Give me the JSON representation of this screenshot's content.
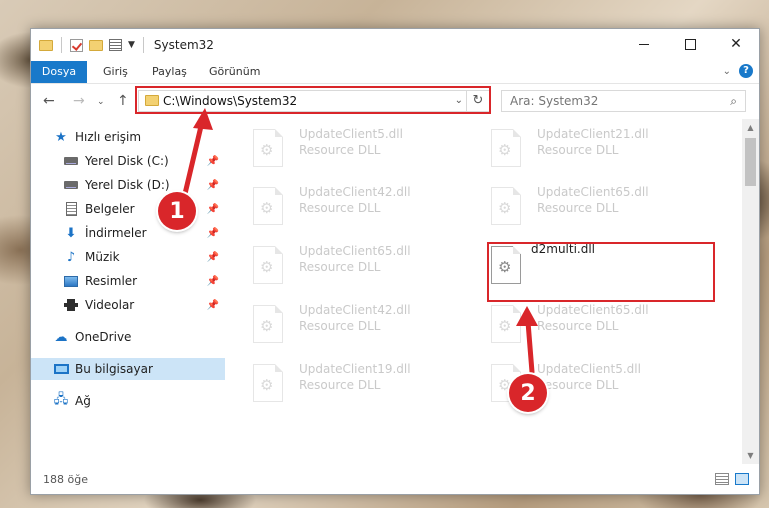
{
  "window": {
    "title": "System32",
    "controls": {
      "minimize": "—",
      "maximize": "☐",
      "close": "✕"
    }
  },
  "ribbon": {
    "tabs": [
      "Dosya",
      "Giriş",
      "Paylaş",
      "Görünüm"
    ],
    "help": "?"
  },
  "address": {
    "path": "C:\\Windows\\System32",
    "search_placeholder": "Ara: System32"
  },
  "nav": {
    "quick_access": "Hızlı erişim",
    "items": [
      {
        "label": "Yerel Disk (C:)",
        "icon": "drive-icon"
      },
      {
        "label": "Yerel Disk (D:)",
        "icon": "drive-icon"
      },
      {
        "label": "Belgeler",
        "icon": "documents-icon"
      },
      {
        "label": "İndirmeler",
        "icon": "downloads-icon"
      },
      {
        "label": "Müzik",
        "icon": "music-icon"
      },
      {
        "label": "Resimler",
        "icon": "pictures-icon"
      },
      {
        "label": "Videolar",
        "icon": "videos-icon"
      }
    ],
    "onedrive": "OneDrive",
    "this_pc": "Bu bilgisayar",
    "network": "Ağ"
  },
  "files": [
    {
      "name": "UpdateClient5.dll",
      "type": "Resource DLL"
    },
    {
      "name": "UpdateClient21.dll",
      "type": "Resource DLL"
    },
    {
      "name": "UpdateClient42.dll",
      "type": "Resource DLL"
    },
    {
      "name": "UpdateClient65.dll",
      "type": "Resource DLL"
    },
    {
      "name": "UpdateClient65.dll",
      "type": "Resource DLL"
    },
    {
      "name": "d2multi.dll",
      "type": ""
    },
    {
      "name": "UpdateClient42.dll",
      "type": "Resource DLL"
    },
    {
      "name": "UpdateClient65.dll",
      "type": "Resource DLL"
    },
    {
      "name": "UpdateClient19.dll",
      "type": "Resource DLL"
    },
    {
      "name": "UpdateClient5.dll",
      "type": "Resource DLL"
    }
  ],
  "status": {
    "count": "188 öğe"
  },
  "markers": {
    "one": "1",
    "two": "2"
  },
  "colors": {
    "accent": "#1979ca",
    "highlight": "#d9262a",
    "selected": "#cce4f7"
  }
}
